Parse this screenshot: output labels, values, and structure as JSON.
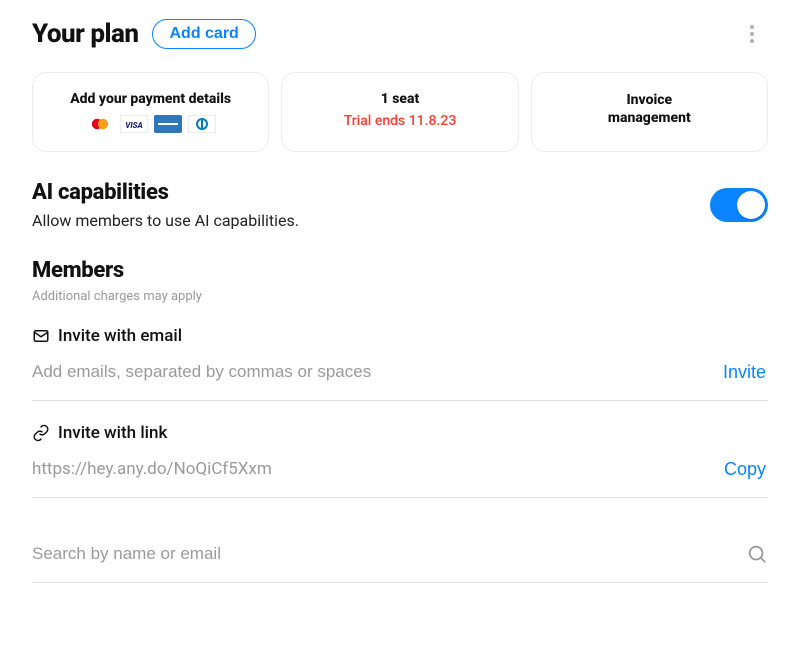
{
  "header": {
    "title": "Your plan",
    "add_card_label": "Add card"
  },
  "cards": {
    "payment": {
      "title": "Add your payment details"
    },
    "seats": {
      "title": "1 seat",
      "sub": "Trial ends 11.8.23"
    },
    "invoice": {
      "title_line1": "Invoice",
      "title_line2": "management"
    }
  },
  "ai": {
    "heading": "AI capabilities",
    "description": "Allow members to use AI capabilities.",
    "enabled": true
  },
  "members": {
    "heading": "Members",
    "hint": "Additional charges may apply",
    "invite_email": {
      "label": "Invite with email",
      "placeholder": "Add emails, separated by commas or spaces",
      "action": "Invite"
    },
    "invite_link": {
      "label": "Invite with link",
      "url": "https://hey.any.do/NoQiCf5Xxm",
      "action": "Copy"
    },
    "search": {
      "placeholder": "Search by name or email"
    }
  },
  "colors": {
    "accent": "#0a84ff",
    "danger": "#ff3b30"
  }
}
